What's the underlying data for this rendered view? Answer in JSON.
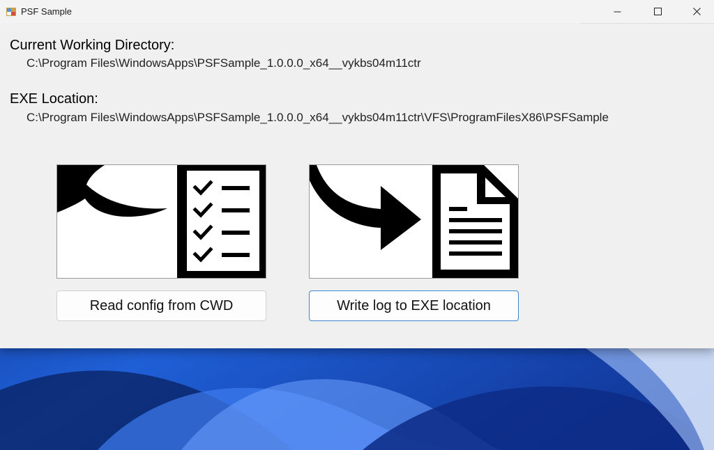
{
  "window": {
    "title": "PSF Sample"
  },
  "cwd": {
    "label": "Current Working Directory:",
    "path": "C:\\Program Files\\WindowsApps\\PSFSample_1.0.0.0_x64__vykbs04m11ctr"
  },
  "exe": {
    "label": "EXE Location:",
    "path": "C:\\Program Files\\WindowsApps\\PSFSample_1.0.0.0_x64__vykbs04m11ctr\\VFS\\ProgramFilesX86\\PSFSample"
  },
  "actions": {
    "read_label": "Read config from CWD",
    "write_label": "Write log to EXE location"
  },
  "colors": {
    "window_bg": "#f0f0f0",
    "focus_border": "#3b87d1",
    "wallpaper": "#1a3f9e"
  }
}
